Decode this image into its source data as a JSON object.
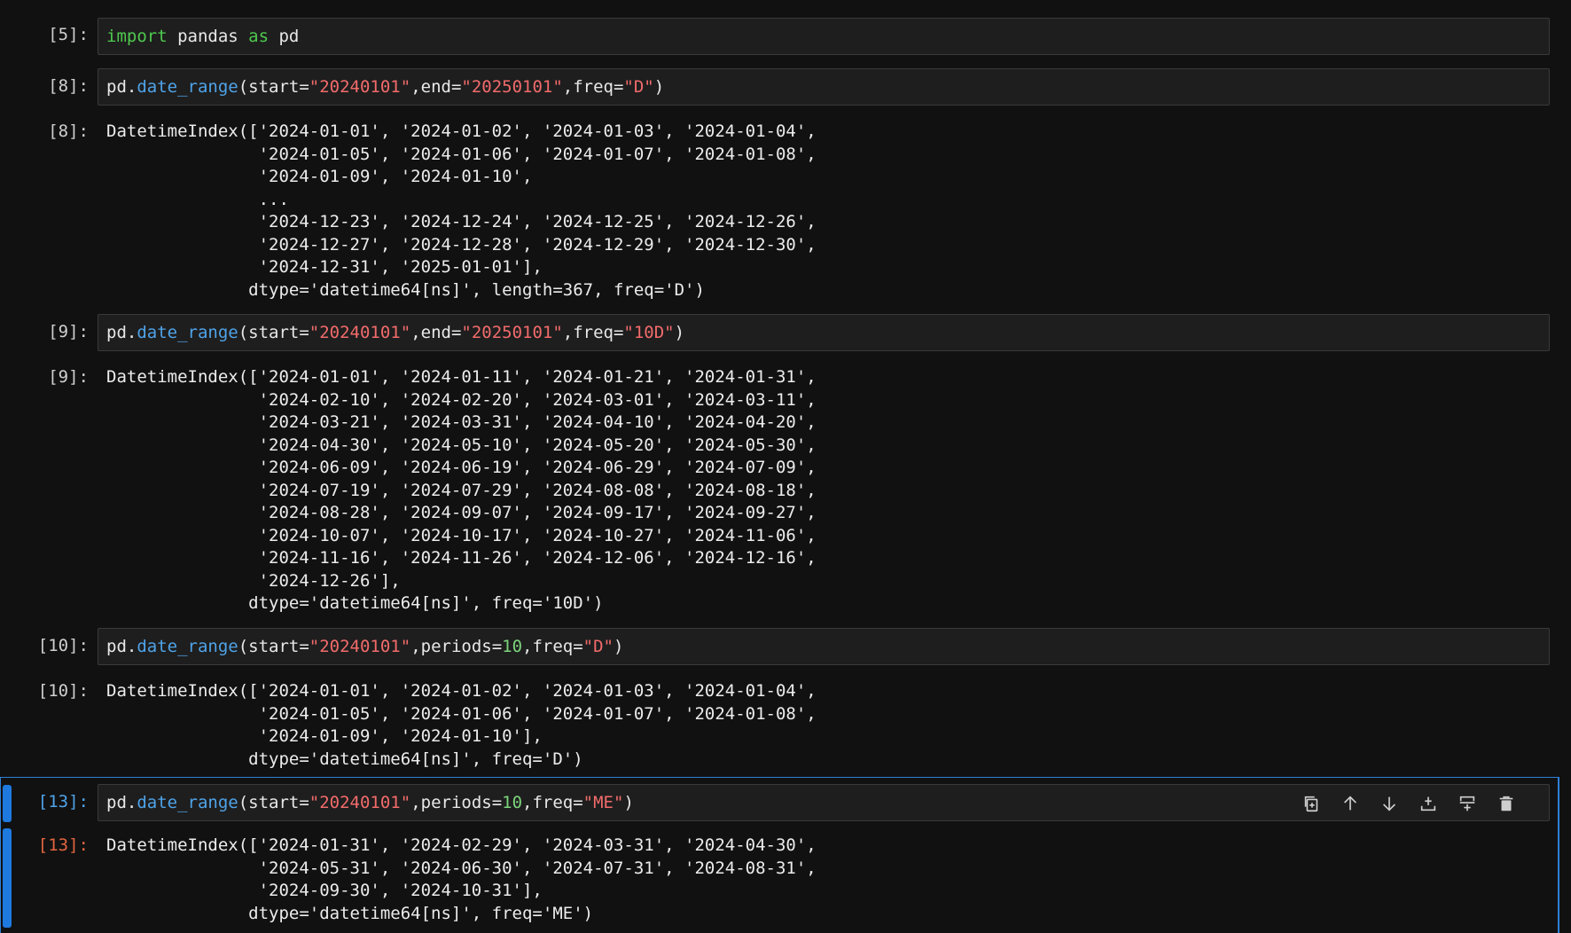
{
  "cells": [
    {
      "in_prompt": "[5]:",
      "code": [
        {
          "t": "import",
          "c": "kw"
        },
        {
          "t": " pandas ",
          "c": ""
        },
        {
          "t": "as",
          "c": "kw"
        },
        {
          "t": " pd",
          "c": ""
        }
      ]
    },
    {
      "in_prompt": "[8]:",
      "code": [
        {
          "t": "pd.",
          "c": ""
        },
        {
          "t": "date_range",
          "c": "fn"
        },
        {
          "t": "(start=",
          "c": ""
        },
        {
          "t": "\"20240101\"",
          "c": "str"
        },
        {
          "t": ",end=",
          "c": ""
        },
        {
          "t": "\"20250101\"",
          "c": "str"
        },
        {
          "t": ",freq=",
          "c": ""
        },
        {
          "t": "\"D\"",
          "c": "str"
        },
        {
          "t": ")",
          "c": ""
        }
      ],
      "out_prompt": "[8]:",
      "output": "DatetimeIndex(['2024-01-01', '2024-01-02', '2024-01-03', '2024-01-04',\n               '2024-01-05', '2024-01-06', '2024-01-07', '2024-01-08',\n               '2024-01-09', '2024-01-10',\n               ...\n               '2024-12-23', '2024-12-24', '2024-12-25', '2024-12-26',\n               '2024-12-27', '2024-12-28', '2024-12-29', '2024-12-30',\n               '2024-12-31', '2025-01-01'],\n              dtype='datetime64[ns]', length=367, freq='D')"
    },
    {
      "in_prompt": "[9]:",
      "code": [
        {
          "t": "pd.",
          "c": ""
        },
        {
          "t": "date_range",
          "c": "fn"
        },
        {
          "t": "(start=",
          "c": ""
        },
        {
          "t": "\"20240101\"",
          "c": "str"
        },
        {
          "t": ",end=",
          "c": ""
        },
        {
          "t": "\"20250101\"",
          "c": "str"
        },
        {
          "t": ",freq=",
          "c": ""
        },
        {
          "t": "\"10D\"",
          "c": "str"
        },
        {
          "t": ")",
          "c": ""
        }
      ],
      "out_prompt": "[9]:",
      "output": "DatetimeIndex(['2024-01-01', '2024-01-11', '2024-01-21', '2024-01-31',\n               '2024-02-10', '2024-02-20', '2024-03-01', '2024-03-11',\n               '2024-03-21', '2024-03-31', '2024-04-10', '2024-04-20',\n               '2024-04-30', '2024-05-10', '2024-05-20', '2024-05-30',\n               '2024-06-09', '2024-06-19', '2024-06-29', '2024-07-09',\n               '2024-07-19', '2024-07-29', '2024-08-08', '2024-08-18',\n               '2024-08-28', '2024-09-07', '2024-09-17', '2024-09-27',\n               '2024-10-07', '2024-10-17', '2024-10-27', '2024-11-06',\n               '2024-11-16', '2024-11-26', '2024-12-06', '2024-12-16',\n               '2024-12-26'],\n              dtype='datetime64[ns]', freq='10D')"
    },
    {
      "in_prompt": "[10]:",
      "code": [
        {
          "t": "pd.",
          "c": ""
        },
        {
          "t": "date_range",
          "c": "fn"
        },
        {
          "t": "(start=",
          "c": ""
        },
        {
          "t": "\"20240101\"",
          "c": "str"
        },
        {
          "t": ",periods=",
          "c": ""
        },
        {
          "t": "10",
          "c": "num"
        },
        {
          "t": ",freq=",
          "c": ""
        },
        {
          "t": "\"D\"",
          "c": "str"
        },
        {
          "t": ")",
          "c": ""
        }
      ],
      "out_prompt": "[10]:",
      "output": "DatetimeIndex(['2024-01-01', '2024-01-02', '2024-01-03', '2024-01-04',\n               '2024-01-05', '2024-01-06', '2024-01-07', '2024-01-08',\n               '2024-01-09', '2024-01-10'],\n              dtype='datetime64[ns]', freq='D')"
    },
    {
      "in_prompt": "[13]:",
      "active": true,
      "code": [
        {
          "t": "pd.",
          "c": ""
        },
        {
          "t": "date_range",
          "c": "fn"
        },
        {
          "t": "(start=",
          "c": ""
        },
        {
          "t": "\"20240101\"",
          "c": "str"
        },
        {
          "t": ",periods=",
          "c": ""
        },
        {
          "t": "10",
          "c": "num"
        },
        {
          "t": ",freq=",
          "c": ""
        },
        {
          "t": "\"ME\"",
          "c": "str"
        },
        {
          "t": ")",
          "c": ""
        }
      ],
      "out_prompt": "[13]:",
      "output": "DatetimeIndex(['2024-01-31', '2024-02-29', '2024-03-31', '2024-04-30',\n               '2024-05-31', '2024-06-30', '2024-07-31', '2024-08-31',\n               '2024-09-30', '2024-10-31'],\n              dtype='datetime64[ns]', freq='ME')"
    }
  ],
  "toolbar": [
    "duplicate-icon",
    "move-up-icon",
    "move-down-icon",
    "insert-above-icon",
    "insert-below-icon",
    "delete-icon"
  ],
  "colors": {
    "background": "#111111",
    "keyword": "#4ec94e",
    "function": "#4fa3e8",
    "string": "#f26b6b",
    "number": "#7cd47c",
    "active_accent": "#1f7ae0",
    "out_prompt_active": "#e0653f"
  }
}
